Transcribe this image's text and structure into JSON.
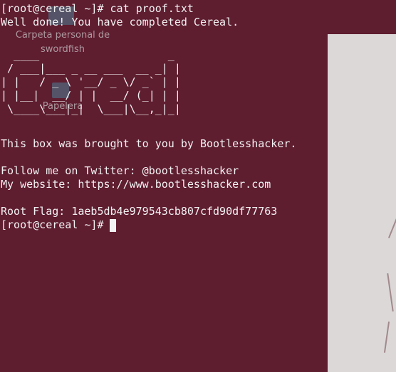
{
  "terminal": {
    "command_line": "[root@cereal ~]# cat proof.txt",
    "message": "Well done! You have completed Cereal.",
    "ascii_art": "  ____                    _ \n / ___|___ _ __ ___  __ _| |\n| |   / _ \\ '__/ _ \\/ _` | |\n| |__|  __/ | |  __/ (_| | |\n \\____\\___|_|  \\___|\\__,_|_|",
    "credit_line": "This box was brought to you by Bootlesshacker.",
    "twitter_line": "Follow me on Twitter: @bootlesshacker",
    "website_line": "My website: https://www.bootlesshacker.com",
    "root_flag_line": "Root Flag: 1aeb5db4e979543cb807cfd90df77763",
    "prompt": "[root@cereal ~]#"
  },
  "desktop": {
    "home_folder_label": "Carpeta personal de\nswordfish",
    "trash_label": "Papelera"
  },
  "colors": {
    "terminal_background": "#5f1d30",
    "terminal_text": "#f2f2f2",
    "desktop_label": "#c9c9c9",
    "side_panel": "#dcd8d8"
  },
  "icons": {
    "home_folder": "home-folder-icon",
    "trash": "trash-icon"
  }
}
